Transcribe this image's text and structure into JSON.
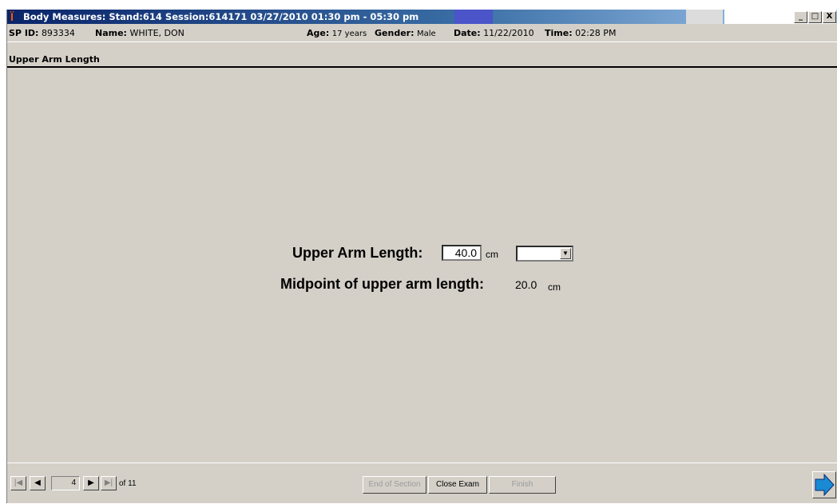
{
  "window": {
    "title": "Body Measures: Stand:614 Session:614171 03/27/2010 01:30 pm - 05:30 pm",
    "controls": [
      "_",
      "□",
      "X"
    ]
  },
  "header": {
    "sp_id_label": "SP ID:",
    "sp_id": "893334",
    "name_label": "Name:",
    "name": "WHITE, DON",
    "age_label": "Age:",
    "age": "17 years",
    "gender_label": "Gender:",
    "gender": "Male",
    "date_label": "Date:",
    "date": "11/22/2010",
    "time_label": "Time:",
    "time": "02:28 PM"
  },
  "section": {
    "title": "Upper Arm Length"
  },
  "form": {
    "upper_arm_label": "Upper Arm Length:",
    "upper_arm_value": "40.0",
    "upper_arm_unit": "cm",
    "comment_select_value": "",
    "midpoint_label": "Midpoint of upper arm length:",
    "midpoint_value": "20.0",
    "midpoint_unit": "cm"
  },
  "footer": {
    "first_icon": "first-page-icon",
    "prev_icon": "previous-page-icon",
    "next_icon": "next-page-icon",
    "last_icon": "last-page-icon",
    "current_page": "4",
    "of_pages": "of 11",
    "end_of_section_label": "End of Section",
    "close_exam_label": "Close Exam",
    "finish_label": "Finish",
    "next_screen_icon": "forward-arrow-icon"
  }
}
